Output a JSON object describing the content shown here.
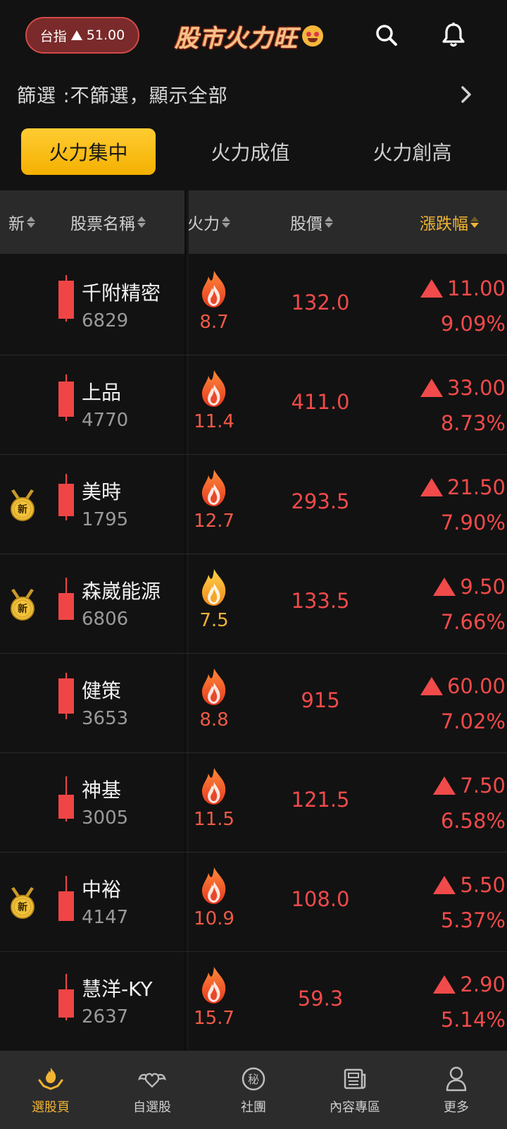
{
  "header": {
    "index_label": "台指",
    "index_value": "51.00",
    "logo_text": "股市火力旺"
  },
  "filter": {
    "text": "篩選 :不篩選，顯示全部"
  },
  "tabs": [
    {
      "label": "火力集中",
      "active": true
    },
    {
      "label": "火力成值",
      "active": false
    },
    {
      "label": "火力創高",
      "active": false
    }
  ],
  "table_header": {
    "new": "新",
    "name": "股票名稱",
    "fire": "火力",
    "price": "股價",
    "change": "漲跌幅"
  },
  "rows": [
    {
      "is_new": false,
      "name": "千附精密",
      "code": "6829",
      "fire": "8.7",
      "fire_color": "#f05a46",
      "price": "132.0",
      "change": "11.00",
      "pct": "9.09%"
    },
    {
      "is_new": false,
      "name": "上品",
      "code": "4770",
      "fire": "11.4",
      "fire_color": "#f05a46",
      "price": "411.0",
      "change": "33.00",
      "pct": "8.73%"
    },
    {
      "is_new": true,
      "new_badge": "新",
      "name": "美時",
      "code": "1795",
      "fire": "12.7",
      "fire_color": "#f05a46",
      "price": "293.5",
      "change": "21.50",
      "pct": "7.90%"
    },
    {
      "is_new": true,
      "new_badge": "新",
      "name": "森崴能源",
      "code": "6806",
      "fire": "7.5",
      "fire_color": "#f4b23a",
      "price": "133.5",
      "change": "9.50",
      "pct": "7.66%"
    },
    {
      "is_new": false,
      "name": "健策",
      "code": "3653",
      "fire": "8.8",
      "fire_color": "#f05a46",
      "price": "915",
      "change": "60.00",
      "pct": "7.02%"
    },
    {
      "is_new": false,
      "name": "神基",
      "code": "3005",
      "fire": "11.5",
      "fire_color": "#f05a46",
      "price": "121.5",
      "change": "7.50",
      "pct": "6.58%"
    },
    {
      "is_new": true,
      "new_badge": "新",
      "name": "中裕",
      "code": "4147",
      "fire": "10.9",
      "fire_color": "#f05a46",
      "price": "108.0",
      "change": "5.50",
      "pct": "5.37%"
    },
    {
      "is_new": false,
      "name": "慧洋-KY",
      "code": "2637",
      "fire": "15.7",
      "fire_color": "#f05a46",
      "price": "59.3",
      "change": "2.90",
      "pct": "5.14%"
    }
  ],
  "bottom_nav": [
    {
      "label": "選股頁",
      "icon": "hands-fire-icon",
      "active": true
    },
    {
      "label": "自選股",
      "icon": "winged-heart-icon",
      "active": false
    },
    {
      "label": "社團",
      "icon": "secret-badge-icon",
      "active": false
    },
    {
      "label": "內容專區",
      "icon": "newspaper-icon",
      "active": false
    },
    {
      "label": "更多",
      "icon": "person-icon",
      "active": false
    }
  ],
  "colors": {
    "accent": "#f2b533",
    "up_red": "#f04a4a",
    "background": "#121212"
  }
}
